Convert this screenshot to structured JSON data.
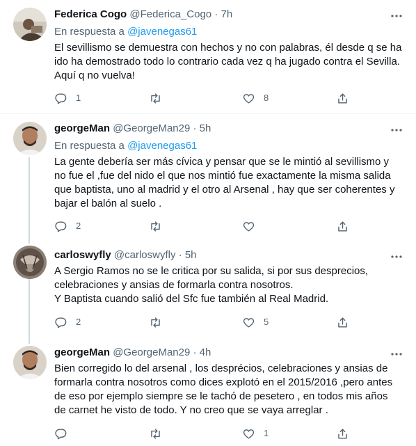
{
  "tweets": [
    {
      "name": "Federica Cogo",
      "handle": "@Federica_Cogo",
      "dot": "·",
      "time": "7h",
      "reply_prefix": "En respuesta a",
      "reply_mention": "@javenegas61",
      "text": "El sevillismo se demuestra con hechos y no con palabras, él desde q se ha ido ha demostrado todo lo contrario cada vez q ha jugado contra el Sevilla.\nAquí q no vuelva!",
      "replies": "1",
      "retweets": "",
      "likes": "8"
    },
    {
      "name": "georgeMan",
      "handle": "@GeorgeMan29",
      "dot": "·",
      "time": "5h",
      "reply_prefix": "En respuesta a",
      "reply_mention": "@javenegas61",
      "text": "La gente debería ser más cívica y pensar que se le mintió al sevillismo y no fue el ,fue del nido el que nos mintió fue exactamente la misma salida que baptista, uno al madrid y el otro al Arsenal , hay que ser coherentes y bajar el balón al suelo .",
      "replies": "2",
      "retweets": "",
      "likes": ""
    },
    {
      "name": "carloswyfly",
      "handle": "@carloswyfly",
      "dot": "·",
      "time": "5h",
      "text": "A Sergio Ramos no se le critica por su salida, si por sus desprecios, celebraciones y ansias de formarla contra nosotros.\nY Baptista cuando salió del Sfc fue también al Real Madrid.",
      "replies": "2",
      "retweets": "",
      "likes": "5"
    },
    {
      "name": "georgeMan",
      "handle": "@GeorgeMan29",
      "dot": "·",
      "time": "4h",
      "text": "Bien corregido lo del arsenal , los desprécios, celebraciones y ansias de formarla contra nosotros como dices explotó en el 2015/2016 ,pero antes de eso por ejemplo siempre se le tachó de pesetero , en todos mis años de carnet he visto de todo. Y no creo que se vaya arreglar .",
      "replies": "",
      "retweets": "",
      "likes": "1"
    }
  ],
  "colors": {
    "text": "#0f1419",
    "secondary": "#536471",
    "link": "#1d9bf0",
    "divider": "#eff3f4",
    "thread_line": "#cfd9de"
  },
  "icons": [
    "more-icon",
    "reply-icon",
    "retweet-icon",
    "like-icon",
    "share-icon"
  ]
}
